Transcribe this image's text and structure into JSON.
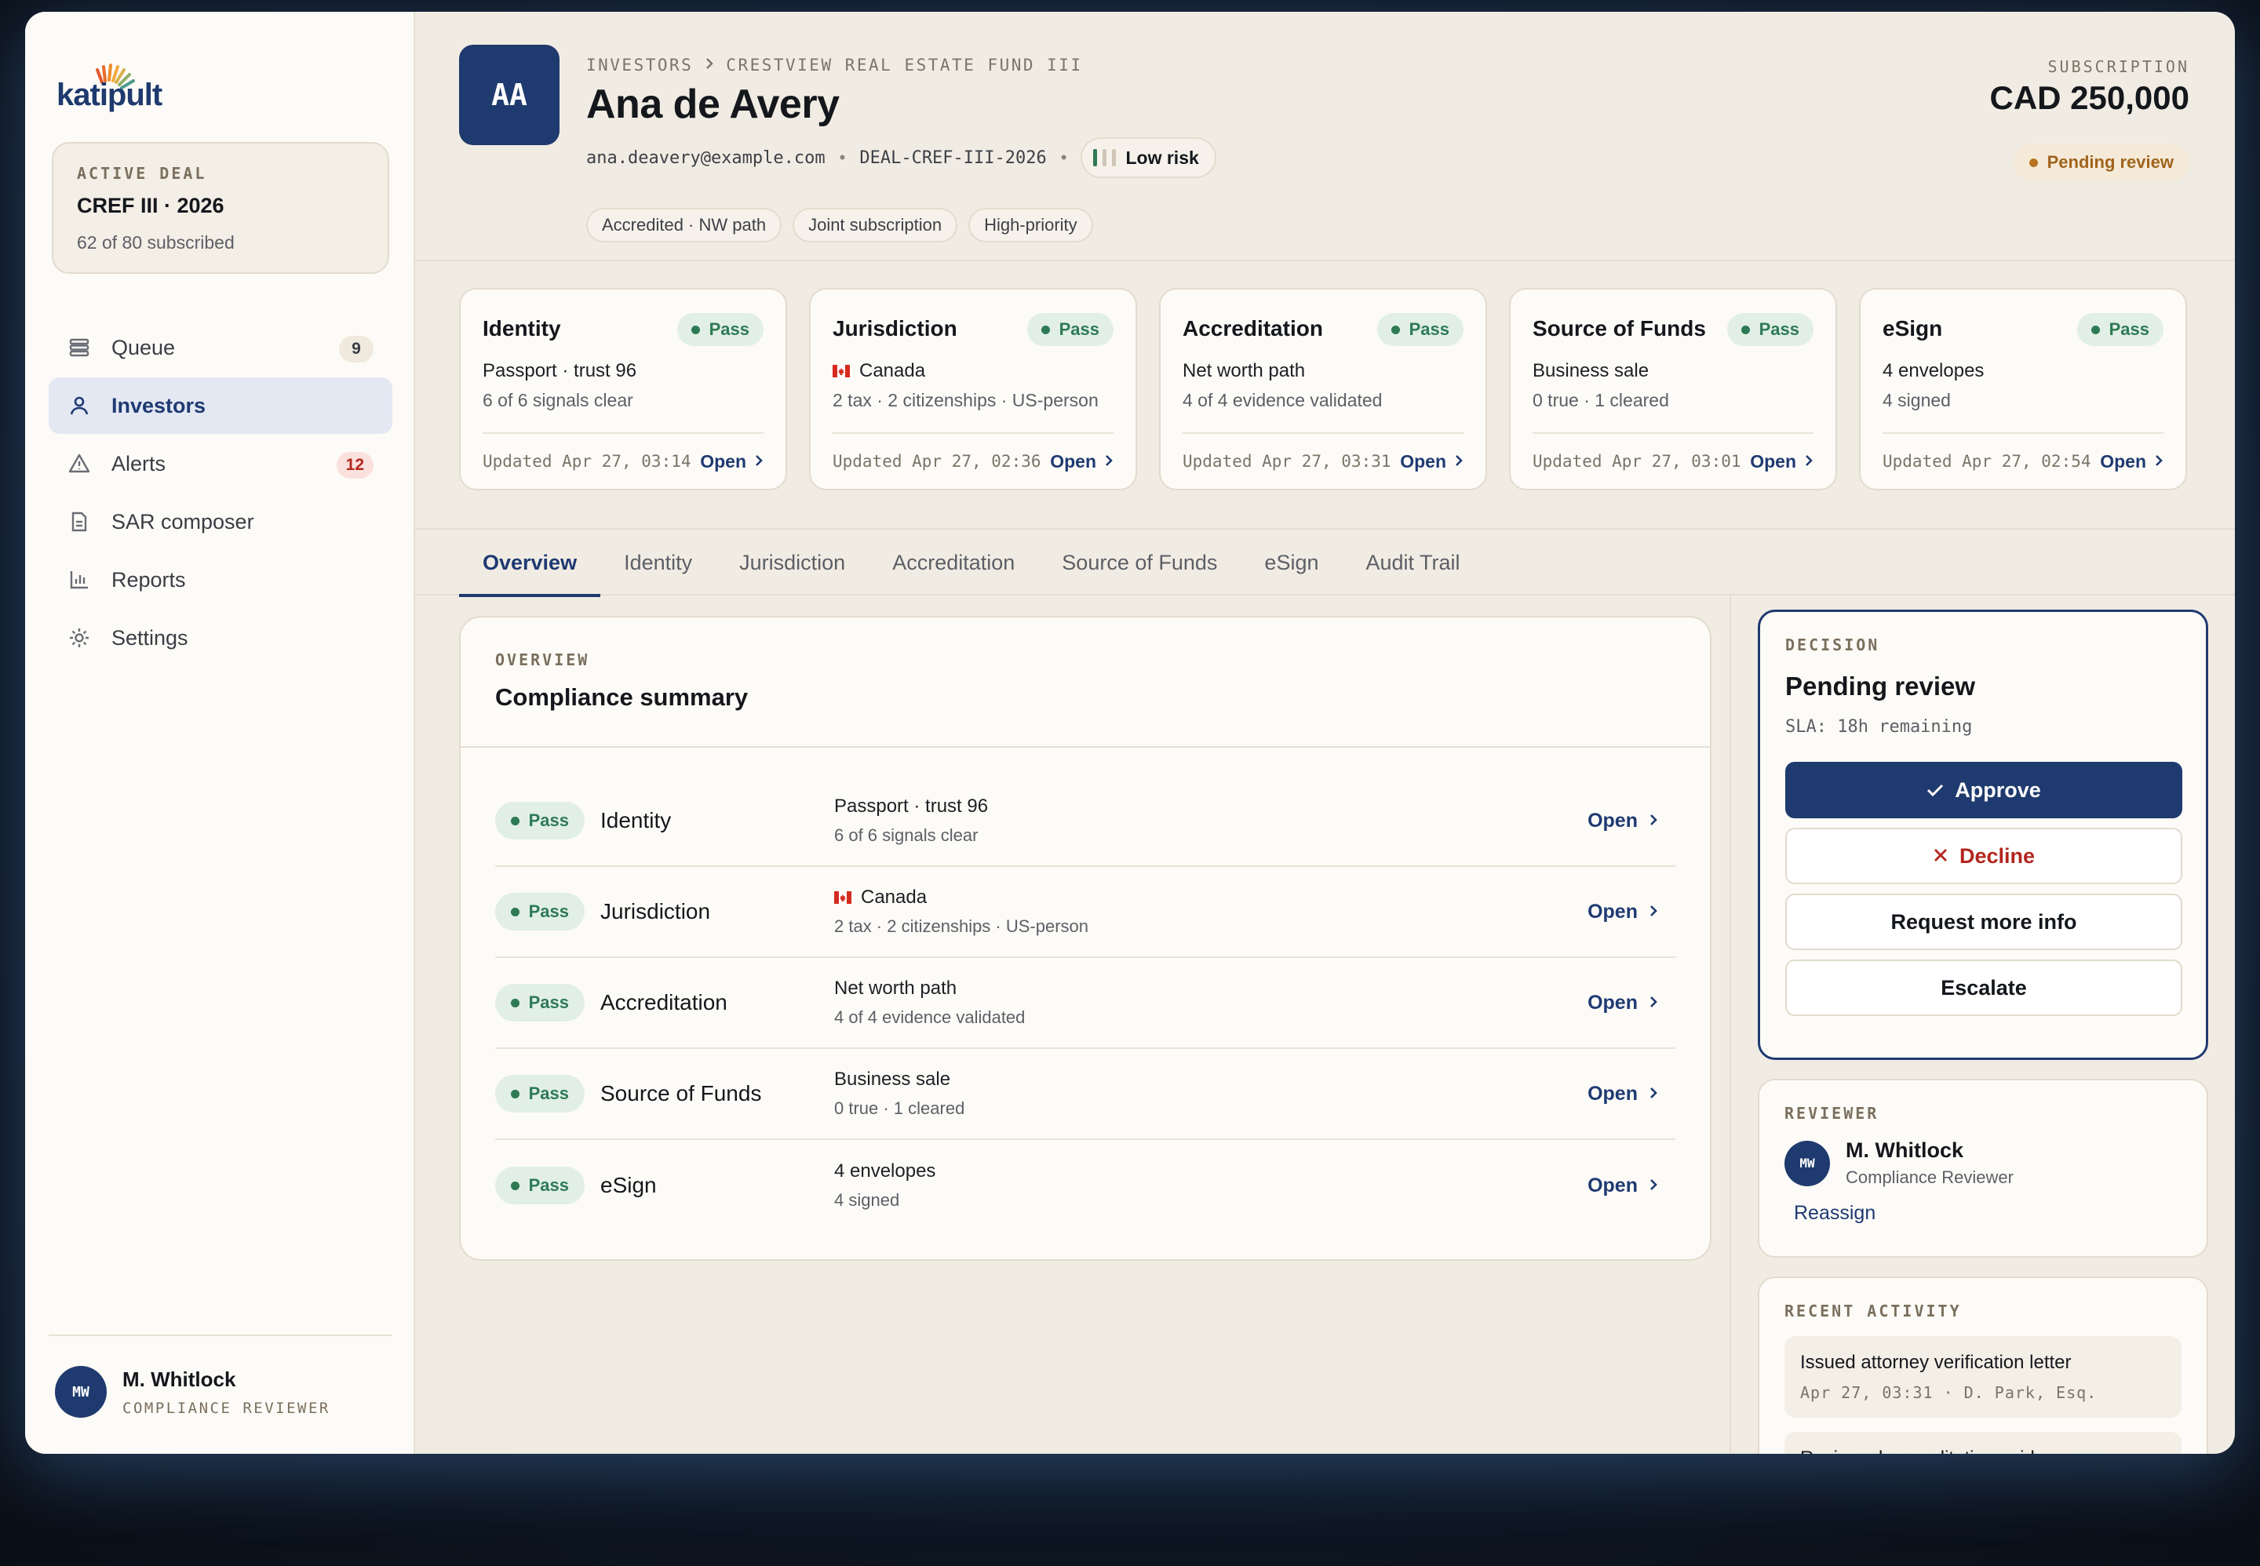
{
  "brand": {
    "name": "katipult"
  },
  "sidebar": {
    "deal": {
      "kicker": "ACTIVE DEAL",
      "name": "CREF III · 2026",
      "progress": "62 of 80 subscribed"
    },
    "items": [
      {
        "label": "Queue",
        "icon": "queue-icon",
        "badge": "9"
      },
      {
        "label": "Investors",
        "icon": "user-icon",
        "badge": ""
      },
      {
        "label": "Alerts",
        "icon": "warning-icon",
        "badge": "12"
      },
      {
        "label": "SAR composer",
        "icon": "document-icon",
        "badge": ""
      },
      {
        "label": "Reports",
        "icon": "bar-chart-icon",
        "badge": ""
      },
      {
        "label": "Settings",
        "icon": "gear-icon",
        "badge": ""
      }
    ],
    "user": {
      "initials": "MW",
      "name": "M. Whitlock",
      "role": "COMPLIANCE REVIEWER"
    }
  },
  "header": {
    "initials": "AA",
    "breadcrumb": [
      "INVESTORS",
      "CRESTVIEW REAL ESTATE FUND III"
    ],
    "name": "Ana de Avery",
    "email": "ana.deavery@example.com",
    "deal_id": "DEAL-CREF-III-2026",
    "risk": "Low risk",
    "tags": [
      "Accredited · NW path",
      "Joint subscription",
      "High-priority"
    ],
    "subscription_kicker": "SUBSCRIPTION",
    "subscription_amount": "CAD 250,000",
    "status": "Pending review"
  },
  "checks": [
    {
      "title": "Identity",
      "status": "Pass",
      "main": "Passport · trust 96",
      "sub": "6 of 6 signals clear",
      "updated": "Updated Apr 27, 03:14",
      "open": "Open",
      "flag": false
    },
    {
      "title": "Jurisdiction",
      "status": "Pass",
      "main": "Canada",
      "sub": "2 tax · 2 citizenships · US-person",
      "updated": "Updated Apr 27, 02:36",
      "open": "Open",
      "flag": true
    },
    {
      "title": "Accreditation",
      "status": "Pass",
      "main": "Net worth path",
      "sub": "4 of 4 evidence validated",
      "updated": "Updated Apr 27, 03:31",
      "open": "Open",
      "flag": false
    },
    {
      "title": "Source of Funds",
      "status": "Pass",
      "main": "Business sale",
      "sub": "0 true · 1 cleared",
      "updated": "Updated Apr 27, 03:01",
      "open": "Open",
      "flag": false
    },
    {
      "title": "eSign",
      "status": "Pass",
      "main": "4 envelopes",
      "sub": "4 signed",
      "updated": "Updated Apr 27, 02:54",
      "open": "Open",
      "flag": false
    }
  ],
  "tabs": [
    "Overview",
    "Identity",
    "Jurisdiction",
    "Accreditation",
    "Source of Funds",
    "eSign",
    "Audit Trail"
  ],
  "overview": {
    "kicker": "OVERVIEW",
    "title": "Compliance summary",
    "rows": [
      {
        "status": "Pass",
        "name": "Identity",
        "d1": "Passport · trust 96",
        "d2": "6 of 6 signals clear",
        "open": "Open"
      },
      {
        "status": "Pass",
        "name": "Jurisdiction",
        "d1": "Canada",
        "d2": "2 tax · 2 citizenships · US-person",
        "open": "Open"
      },
      {
        "status": "Pass",
        "name": "Accreditation",
        "d1": "Net worth path",
        "d2": "4 of 4 evidence validated",
        "open": "Open"
      },
      {
        "status": "Pass",
        "name": "Source of Funds",
        "d1": "Business sale",
        "d2": "0 true · 1 cleared",
        "open": "Open"
      },
      {
        "status": "Pass",
        "name": "eSign",
        "d1": "4 envelopes",
        "d2": "4 signed",
        "open": "Open"
      }
    ]
  },
  "decision": {
    "kicker": "DECISION",
    "title": "Pending review",
    "sla": "SLA: 18h remaining",
    "approve": "Approve",
    "decline": "Decline",
    "more_info": "Request more info",
    "escalate": "Escalate"
  },
  "reviewer": {
    "kicker": "REVIEWER",
    "initials": "MW",
    "name": "M. Whitlock",
    "role": "Compliance Reviewer",
    "reassign": "Reassign"
  },
  "activity": {
    "kicker": "RECENT ACTIVITY",
    "items": [
      {
        "title": "Issued attorney verification letter",
        "meta": "Apr 27, 03:31 · D. Park, Esq."
      },
      {
        "title": "Reviewed accreditation evidence",
        "meta": ""
      }
    ]
  },
  "colors": {
    "brand_navy": "#1f3a6e",
    "pass_green": "#2e7a55",
    "pending_amber": "#a0641c",
    "alert_red": "#b3261e"
  }
}
